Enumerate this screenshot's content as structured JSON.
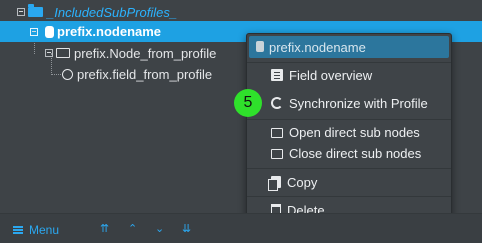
{
  "tree": {
    "top_item": "_IncludedSubProfiles_",
    "selected_item": "prefix.nodename",
    "child_item": "prefix.Node_from_profile",
    "field_item": "prefix.field_from_profile"
  },
  "context_menu": {
    "header": "prefix.nodename",
    "items": [
      {
        "label": "Field overview",
        "icon": "list-icon"
      },
      {
        "label": "Synchronize with Profile",
        "icon": "sync-icon"
      },
      {
        "label": "Open direct sub nodes",
        "icon": "folder-open-icon"
      },
      {
        "label": "Close direct sub nodes",
        "icon": "folder-icon"
      },
      {
        "label": "Copy",
        "icon": "copy-icon"
      },
      {
        "label": "Delete",
        "icon": "trash-icon"
      }
    ]
  },
  "step_badge": "5",
  "bottom_bar": {
    "menu_label": "Menu",
    "nav": [
      "⇈",
      "⌃",
      "⌄",
      "⇊"
    ]
  }
}
